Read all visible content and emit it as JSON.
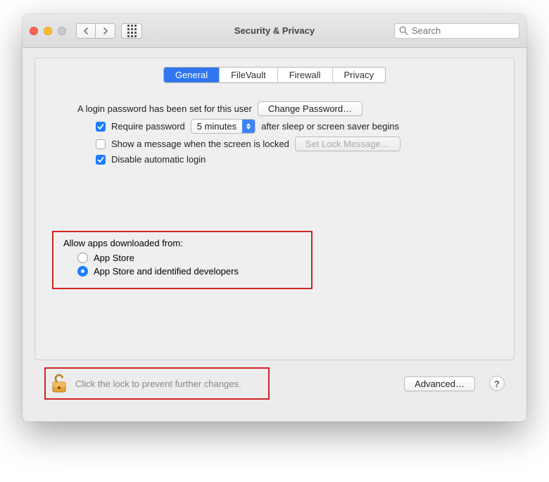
{
  "toolbar": {
    "title": "Security & Privacy",
    "search_placeholder": "Search"
  },
  "tabs": [
    {
      "id": "general",
      "label": "General",
      "active": true
    },
    {
      "id": "filevault",
      "label": "FileVault",
      "active": false
    },
    {
      "id": "firewall",
      "label": "Firewall",
      "active": false
    },
    {
      "id": "privacy",
      "label": "Privacy",
      "active": false
    }
  ],
  "general": {
    "password_set_text": "A login password has been set for this user",
    "change_password_label": "Change Password…",
    "require_password": {
      "checked": true,
      "prefix": "Require password",
      "select_value": "5 minutes",
      "suffix": "after sleep or screen saver begins"
    },
    "show_message": {
      "checked": false,
      "label": "Show a message when the screen is locked",
      "button": "Set Lock Message…",
      "button_enabled": false
    },
    "disable_auto_login": {
      "checked": true,
      "label": "Disable automatic login"
    },
    "allow_apps": {
      "heading": "Allow apps downloaded from:",
      "options": [
        {
          "id": "appstore",
          "label": "App Store",
          "selected": false
        },
        {
          "id": "identified",
          "label": "App Store and identified developers",
          "selected": true
        }
      ]
    }
  },
  "footer": {
    "lock_text": "Click the lock to prevent further changes.",
    "advanced_label": "Advanced…",
    "help_label": "?"
  }
}
